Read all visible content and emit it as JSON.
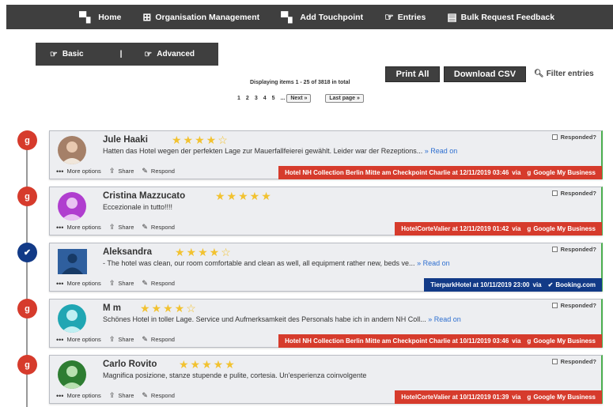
{
  "nav": [
    {
      "label": "Home",
      "icon": "home-icon"
    },
    {
      "label": "Organisation Management",
      "icon": "org-icon"
    },
    {
      "label": "Add Touchpoint",
      "icon": "touchpoint-icon"
    },
    {
      "label": "Entries",
      "icon": "entries-icon"
    },
    {
      "label": "Bulk Request Feedback",
      "icon": "feedback-icon"
    }
  ],
  "modes": {
    "basic": "Basic",
    "separator": "|",
    "advanced": "Advanced"
  },
  "toolbar": {
    "print_all": "Print All",
    "download_csv": "Download CSV",
    "filter": "Filter entries"
  },
  "paging": {
    "displaying": "Displaying items 1 - 25 of 3818 in total",
    "pages": [
      "1",
      "2",
      "3",
      "4",
      "5",
      "..."
    ],
    "next": "Next »",
    "last": "Last page »"
  },
  "colors": {
    "red": "#d63b2c",
    "navy": "#123a87",
    "star": "#f2c230",
    "green_border": "#4caf50"
  },
  "labels": {
    "more_options": "More options",
    "share": "Share",
    "respond": "Respond",
    "responded": "Responded?",
    "read_on": "» Read on",
    "via": "via"
  },
  "entries": [
    {
      "name": "Jule Haaki",
      "rating": 4,
      "text": "Hatten das Hotel wegen der perfekten Lage zur Mauerfallfeierei gewählt. Leider war der Rezeptions...",
      "read_on": true,
      "source": "Hotel NH Collection Berlin Mitte am Checkpoint Charlie at 12/11/2019 03:46",
      "platform": "Google My Business",
      "color": "red"
    },
    {
      "name": "Cristina Mazzucato",
      "rating": 5,
      "text": "Eccezionale in tutto!!!!",
      "read_on": false,
      "source": "HotelCorteValier at 12/11/2019 01:42",
      "platform": "Google My Business",
      "color": "red"
    },
    {
      "name": "Aleksandra",
      "rating": 4,
      "text": "- The hotel was clean, our room comfortable and clean as well, all equipment rather new, beds ve...",
      "read_on": true,
      "source": "TierparkHotel at 10/11/2019 23:00",
      "platform": "Booking.com",
      "color": "navy"
    },
    {
      "name": "M m",
      "rating": 4,
      "text": "Schönes Hotel in toller Lage. Service und Aufmerksamkeit des Personals habe ich in andern NH Coll...",
      "read_on": true,
      "source": "Hotel NH Collection Berlin Mitte am Checkpoint Charlie at 10/11/2019 03:46",
      "platform": "Google My Business",
      "color": "red"
    },
    {
      "name": "Carlo Rovito",
      "rating": 5,
      "text": "Magnifica posizione, stanze stupende e pulite, cortesia. Un'esperienza coinvolgente",
      "read_on": false,
      "source": "HotelCorteValier at 10/11/2019 01:39",
      "platform": "Google My Business",
      "color": "red"
    }
  ]
}
